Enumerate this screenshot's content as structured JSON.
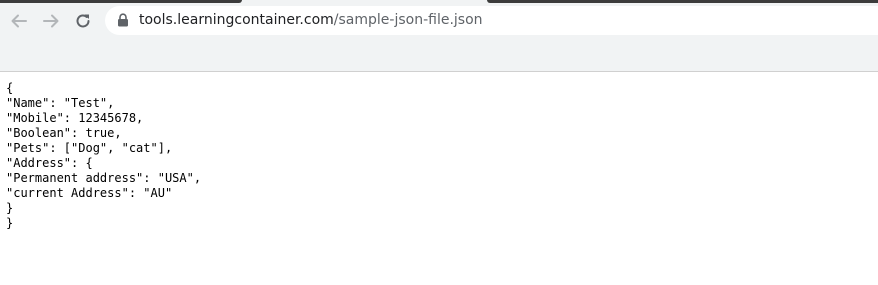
{
  "browser": {
    "url_host": "tools.learningcontainer.com",
    "url_path": "/sample-json-file.json",
    "icons": {
      "back": "arrow-left-icon",
      "forward": "arrow-right-icon",
      "reload": "reload-icon",
      "secure": "lock-icon"
    },
    "colors": {
      "toolbar_bg": "#f1f3f4",
      "tab_dark": "#3c3c3c",
      "icon_disabled": "#b3b6b9",
      "icon_active": "#5f6368"
    }
  },
  "document": {
    "lines": [
      "{",
      "\"Name\": \"Test\",",
      "\"Mobile\": 12345678,",
      "\"Boolean\": true,",
      "\"Pets\": [\"Dog\", \"cat\"],",
      "\"Address\": {",
      "\"Permanent address\": \"USA\",",
      "\"current Address\": \"AU\"",
      "}",
      "}"
    ]
  }
}
